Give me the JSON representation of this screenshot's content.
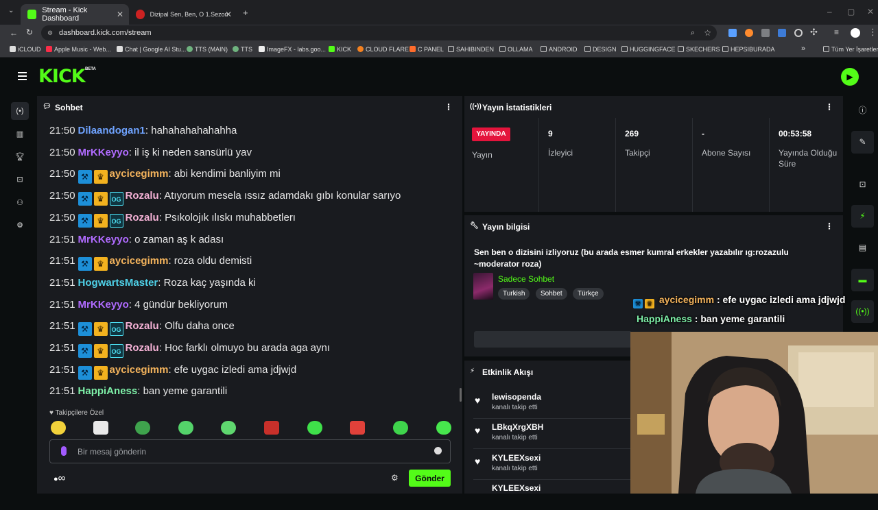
{
  "browser": {
    "tabs": [
      {
        "title": "Stream - Kick Dashboard",
        "active": true
      },
      {
        "title": "Dizipal Sen, Ben, O 1.Sezon 1.B",
        "active": false
      }
    ],
    "url": "dashboard.kick.com/stream",
    "bookmarks": [
      "iCLOUD",
      "Apple Music - Web...",
      "Chat | Google AI Stu...",
      "TTS (MAIN)",
      "TTS",
      "ImageFX - labs.goo...",
      "KICK",
      "CLOUD FLARE",
      "C PANEL",
      "SAHIBINDEN",
      "OLLAMA",
      "ANDROID",
      "DESIGN",
      "HUGGINGFACE",
      "SKECHERS",
      "HEPSIBURADA"
    ],
    "bookmarks_overflow": "»",
    "all_bookmarks": "Tüm Yer İşaretleri"
  },
  "header": {
    "logo": "KICK",
    "beta": "BETA"
  },
  "colors": {
    "accent": "#53fc18",
    "live": "#e4143c",
    "panel": "#191b1f",
    "bg": "#0b0e0f"
  },
  "chat": {
    "title": "Sohbet",
    "messages": [
      {
        "time": "21:50",
        "user": "Dilaandogan1",
        "color": "#6fa3ff",
        "badges": [],
        "text": "hahahahahahahha"
      },
      {
        "time": "21:50",
        "user": "MrKKeyyo",
        "color": "#b06bff",
        "badges": [],
        "text": "il iş ki neden sansürlü yav"
      },
      {
        "time": "21:50",
        "user": "aycicegimm",
        "color": "#f3b35c",
        "badges": [
          "mod",
          "vip"
        ],
        "text": "abi kendimi banliyim mi"
      },
      {
        "time": "21:50",
        "user": "Rozalu",
        "color": "#f5b2d6",
        "badges": [
          "mod",
          "vip",
          "og"
        ],
        "text": "Atıyorum mesela ıssız adamdakı gıbı konular sarıyo"
      },
      {
        "time": "21:50",
        "user": "Rozalu",
        "color": "#f5b2d6",
        "badges": [
          "mod",
          "vip",
          "og"
        ],
        "text": "Psıkolojık ılıskı muhabbetlerı"
      },
      {
        "time": "21:51",
        "user": "MrKKeyyo",
        "color": "#b06bff",
        "badges": [],
        "text": "o zaman aş k adası"
      },
      {
        "time": "21:51",
        "user": "aycicegimm",
        "color": "#f3b35c",
        "badges": [
          "mod",
          "vip"
        ],
        "text": "roza oldu demisti"
      },
      {
        "time": "21:51",
        "user": "HogwartsMaster",
        "color": "#4fd1e8",
        "badges": [],
        "text": "Roza kaç yaşında ki"
      },
      {
        "time": "21:51",
        "user": "MrKKeyyo",
        "color": "#b06bff",
        "badges": [],
        "text": "4 gündür bekliyorum"
      },
      {
        "time": "21:51",
        "user": "Rozalu",
        "color": "#f5b2d6",
        "badges": [
          "mod",
          "vip",
          "og"
        ],
        "text": "Olfu daha once"
      },
      {
        "time": "21:51",
        "user": "Rozalu",
        "color": "#f5b2d6",
        "badges": [
          "mod",
          "vip",
          "og"
        ],
        "text": "Hoc farklı olmuyo bu arada aga aynı"
      },
      {
        "time": "21:51",
        "user": "aycicegimm",
        "color": "#f3b35c",
        "badges": [
          "mod",
          "vip"
        ],
        "text": "efe uygac izledi ama jdjwjd"
      },
      {
        "time": "21:51",
        "user": "HappiAness",
        "color": "#7ef0a8",
        "badges": [],
        "text": "ban yeme garantili"
      }
    ],
    "emote_label": "Takipçilere Özel",
    "input_placeholder": "Bir mesaj gönderin",
    "send_label": "Gönder",
    "infinity": "∞"
  },
  "stats": {
    "title": "Yayın İstatistikleri",
    "live_label": "YAYINDA",
    "live_sub": "Yayın",
    "viewers": {
      "value": "9",
      "label": "İzleyici"
    },
    "followers": {
      "value": "269",
      "label": "Takipçi"
    },
    "subs": {
      "value": "-",
      "label": "Abone Sayısı"
    },
    "uptime": {
      "value": "00:53:58",
      "label": "Yayında Olduğu Süre"
    }
  },
  "info": {
    "title": "Yayın bilgisi",
    "stream_title": "Sen ben o dizisini izliyoruz (bu arada esmer kumral erkekler yazabılır ıg:rozazulu ~moderator roza)",
    "category": "Sadece Sohbet",
    "tags": [
      "Turkish",
      "Sohbet",
      "Türkçe"
    ]
  },
  "activity": {
    "title": "Etkinlik Akışı",
    "items": [
      {
        "name": "lewisopenda",
        "event": "kanalı takip etti"
      },
      {
        "name": "LBkqXrgXBH",
        "event": "kanalı takip etti"
      },
      {
        "name": "KYLEEXsexi",
        "event": "kanalı takip etti"
      },
      {
        "name": "KYLEEXsexi",
        "event": ""
      }
    ]
  },
  "overlay": [
    {
      "user": "aycicegimm",
      "text": "efe uygac izledi ama jdjwjd",
      "color": "#f3b35c"
    },
    {
      "user": "HappiAness",
      "text": "ban yeme garantili",
      "color": "#7ef0a8"
    }
  ]
}
